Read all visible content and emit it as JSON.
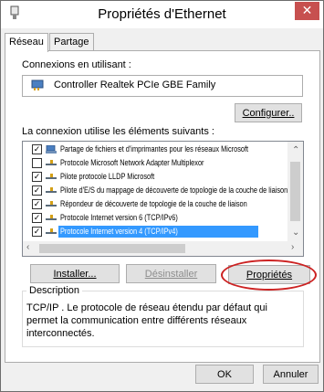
{
  "window": {
    "title": "Propriétés d'Ethernet",
    "close_symbol": "✕"
  },
  "tabs": [
    {
      "label": "Réseau",
      "active": true
    },
    {
      "label": "Partage",
      "active": false
    }
  ],
  "connect_using_label": "Connexions en utilisant :",
  "adapter_name": "Controller Realtek PCIe GBE Family",
  "configure_label": "Configurer..",
  "items_label": "La connexion utilise les éléments suivants :",
  "items": [
    {
      "label": "Partage de fichiers et d'imprimantes pour les réseaux Microsoft",
      "checked": true,
      "icon": "network-share-icon"
    },
    {
      "label": "Protocole Microsoft Network Adapter Multiplexor",
      "checked": false,
      "icon": "protocol-icon"
    },
    {
      "label": "Pilote protocole LLDP Microsoft",
      "checked": true,
      "icon": "protocol-icon"
    },
    {
      "label": "Pilote d'E/S du mappage de découverte de topologie de la couche de liaison",
      "checked": true,
      "icon": "protocol-icon"
    },
    {
      "label": "Répondeur de découverte de topologie de la couche de liaison",
      "checked": true,
      "icon": "protocol-icon"
    },
    {
      "label": "Protocole Internet version 6 (TCP/IPv6)",
      "checked": true,
      "icon": "protocol-icon"
    },
    {
      "label": "Protocole Internet version 4 (TCP/IPv4)",
      "checked": true,
      "icon": "protocol-icon",
      "selected": true
    }
  ],
  "buttons": {
    "install": "Installer...",
    "uninstall": "Désinstaller",
    "properties": "Propriétés",
    "ok": "OK",
    "cancel": "Annuler"
  },
  "description": {
    "label": "Description",
    "text": "TCP/IP . Le protocole de réseau étendu par défaut qui permet la communication entre différents réseaux interconnectés."
  },
  "colors": {
    "selection": "#3399ff",
    "close_button": "#c7504f",
    "highlight_ellipse": "#cc2222"
  }
}
